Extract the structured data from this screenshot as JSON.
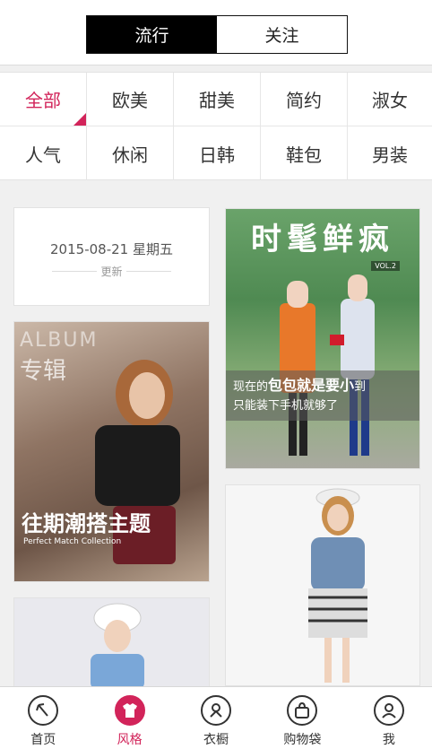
{
  "segment": {
    "tabs": [
      "流行",
      "关注"
    ],
    "active_index": 0
  },
  "categories": [
    {
      "label": "全部",
      "selected": true
    },
    {
      "label": "欧美",
      "selected": false
    },
    {
      "label": "甜美",
      "selected": false
    },
    {
      "label": "简约",
      "selected": false
    },
    {
      "label": "淑女",
      "selected": false
    },
    {
      "label": "人气",
      "selected": false
    },
    {
      "label": "休闲",
      "selected": false
    },
    {
      "label": "日韩",
      "selected": false
    },
    {
      "label": "鞋包",
      "selected": false
    },
    {
      "label": "男装",
      "selected": false
    }
  ],
  "date_card": {
    "date": "2015-08-21 星期五",
    "update_label": "更新"
  },
  "fashion_card": {
    "title": "时髦鲜疯",
    "vol": "VOL.2",
    "caption_line1_a": "现在的",
    "caption_line1_b": "包包就是要小",
    "caption_line1_c": "到",
    "caption_line2": "只能装下手机就够了"
  },
  "album_card": {
    "album": "ALBUM",
    "album_cn": "专辑",
    "title": "往期潮搭主题",
    "subtitle": "Perfect Match Collection"
  },
  "tabbar": [
    {
      "label": "首页",
      "icon": "home-icon",
      "active": false
    },
    {
      "label": "风格",
      "icon": "tshirt-icon",
      "active": true
    },
    {
      "label": "衣橱",
      "icon": "wardrobe-icon",
      "active": false
    },
    {
      "label": "购物袋",
      "icon": "bag-icon",
      "active": false
    },
    {
      "label": "我",
      "icon": "user-icon",
      "active": false
    }
  ],
  "colors": {
    "accent": "#d2245a"
  }
}
